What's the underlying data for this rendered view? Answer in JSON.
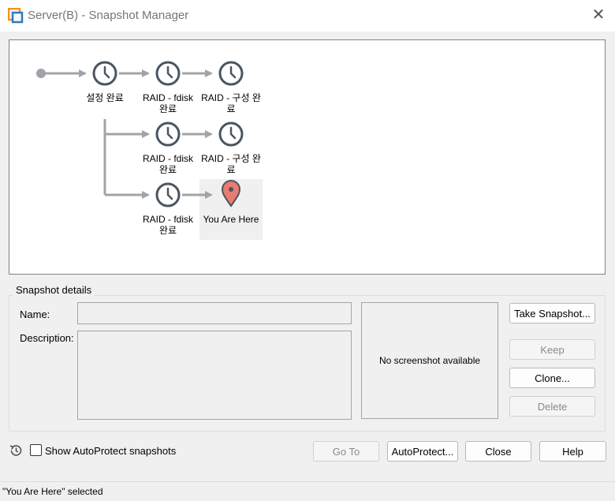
{
  "window": {
    "title": "Server(B) - Snapshot Manager"
  },
  "tree": {
    "nodes": [
      {
        "label_line1": "설정 완료",
        "label_line2": ""
      },
      {
        "label_line1": "RAID - fdisk",
        "label_line2": "완료"
      },
      {
        "label_line1": "RAID - 구성 완",
        "label_line2": "료"
      },
      {
        "label_line1": "RAID - fdisk",
        "label_line2": "완료"
      },
      {
        "label_line1": "RAID - 구성 완",
        "label_line2": "료"
      },
      {
        "label_line1": "RAID - fdisk",
        "label_line2": "완료"
      }
    ],
    "current": {
      "label": "You Are Here"
    },
    "colors": {
      "line": "#a0a4a8",
      "icon": "#4a555f",
      "pin": "#e87b73"
    }
  },
  "details": {
    "legend": "Snapshot details",
    "name_label": "Name:",
    "name_value": "",
    "description_label": "Description:",
    "description_value": "",
    "screenshot_text": "No screenshot available"
  },
  "buttons": {
    "take_snapshot": "Take Snapshot...",
    "keep": "Keep",
    "clone": "Clone...",
    "delete": "Delete",
    "go_to": "Go To",
    "autoprotect": "AutoProtect...",
    "close": "Close",
    "help": "Help"
  },
  "footer": {
    "show_autoprotect_label": "Show AutoProtect snapshots",
    "show_autoprotect_checked": false
  },
  "status": {
    "text": "\"You Are Here\" selected"
  }
}
